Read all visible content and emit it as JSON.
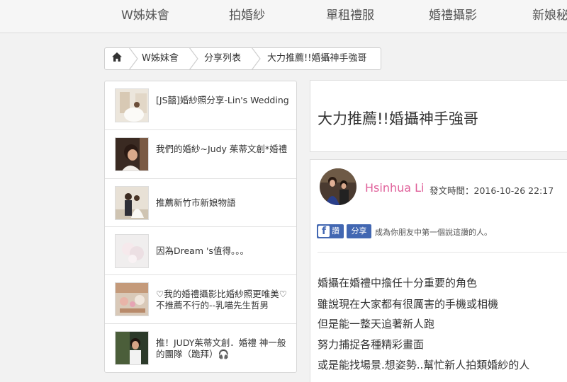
{
  "nav": [
    "W姊妹會",
    "拍婚紗",
    "單租禮服",
    "婚禮攝影",
    "新娘秘"
  ],
  "breadcrumb": {
    "home_icon": "home-icon",
    "items": [
      "W姊妹會",
      "分享列表",
      "大力推薦!!婚攝神手強哥"
    ]
  },
  "sidebar": {
    "posts": [
      {
        "title": "[JS囍]婚紗照分享-Lin's Wedding"
      },
      {
        "title": "我們的婚紗~Judy 茱蒂文創*婚禮"
      },
      {
        "title": "推薦新竹市新娘物語"
      },
      {
        "title": "因為Dream 's值得。。。"
      },
      {
        "title": "♡我的婚禮攝影比婚紗照更唯美♡不推薦不行的--乳喵先生哲男"
      },
      {
        "title": "推！JUDY茱蒂文創．婚禮 神一般的團隊（跪拜）🎧"
      }
    ]
  },
  "article": {
    "title": "大力推薦!!婚攝神手強哥",
    "author": "Hsinhua Li",
    "published": "發文時間：2016-10-26 22:17",
    "fb_like_label": "讚",
    "fb_share_label": "分享",
    "fb_prompt": "成為你朋友中第一個說這讚的人。",
    "lines": [
      "婚攝在婚禮中擔任十分重要的角色",
      "雖說現在大家都有很厲害的手機或相機",
      "但是能一整天追著新人跑",
      "努力捕捉各種精彩畫面",
      "或是能找場景.想姿勢..幫忙新人拍類婚紗的人"
    ]
  },
  "colors": {
    "author_pink": "#e0609a",
    "facebook_blue": "#4267b2"
  }
}
